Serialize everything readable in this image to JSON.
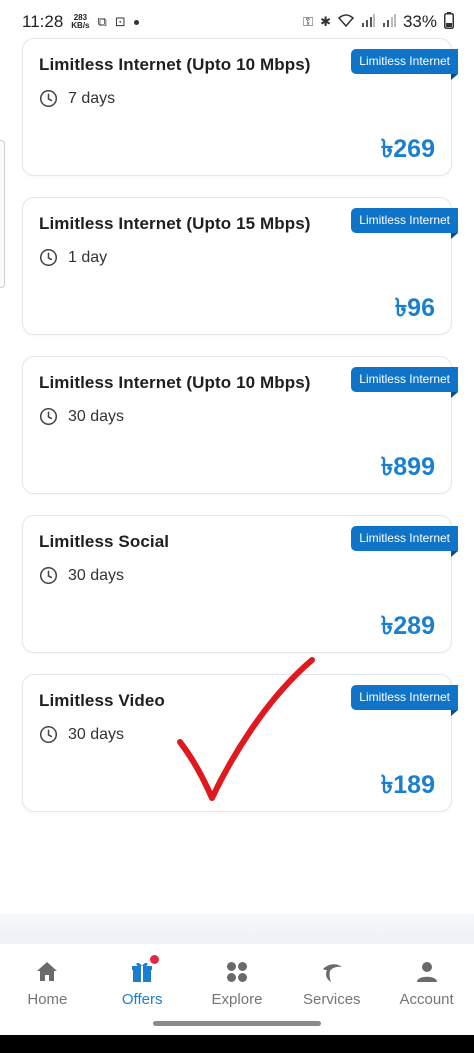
{
  "status_bar": {
    "time": "11:28",
    "speed_value": "283",
    "speed_unit": "KB/s",
    "battery": "33%"
  },
  "offers": [
    {
      "title": "Limitless Internet (Upto 10 Mbps)",
      "duration": "7 days",
      "price": "৳269",
      "tag": "Limitless Internet"
    },
    {
      "title": "Limitless Internet (Upto 15 Mbps)",
      "duration": "1 day",
      "price": "৳96",
      "tag": "Limitless Internet"
    },
    {
      "title": "Limitless Internet (Upto 10 Mbps)",
      "duration": "30 days",
      "price": "৳899",
      "tag": "Limitless Internet"
    },
    {
      "title": "Limitless Social",
      "duration": "30 days",
      "price": "৳289",
      "tag": "Limitless Internet"
    },
    {
      "title": "Limitless Video",
      "duration": "30 days",
      "price": "৳189",
      "tag": "Limitless Internet"
    }
  ],
  "nav": {
    "items": [
      {
        "label": "Home",
        "icon": "home-icon"
      },
      {
        "label": "Offers",
        "icon": "gift-icon"
      },
      {
        "label": "Explore",
        "icon": "grid-icon"
      },
      {
        "label": "Services",
        "icon": "telenor-icon"
      },
      {
        "label": "Account",
        "icon": "person-icon"
      }
    ],
    "active": "Offers"
  },
  "colors": {
    "accent": "#1a7fd0",
    "tag_bg": "#0f74c8",
    "notification": "#e02a43",
    "annotation": "#e0191f"
  }
}
